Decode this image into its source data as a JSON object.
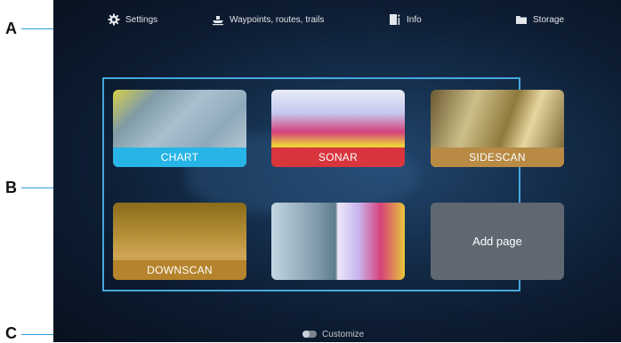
{
  "callouts": {
    "a": "A",
    "b": "B",
    "c": "C"
  },
  "top_bar": {
    "settings": {
      "label": "Settings",
      "icon": "gear-icon"
    },
    "waypoints": {
      "label": "Waypoints, routes, trails",
      "icon": "boat-icon"
    },
    "info": {
      "label": "Info",
      "icon": "info-icon"
    },
    "storage": {
      "label": "Storage",
      "icon": "folder-icon"
    }
  },
  "pages": {
    "chart": "CHART",
    "sonar": "SONAR",
    "sidescan": "SIDESCAN",
    "downscan": "DOWNSCAN",
    "add_page": "Add page"
  },
  "footer": {
    "customize": "Customize",
    "toggle_icon": "toggle-icon"
  },
  "colors": {
    "accent": "#45a8dc",
    "chart": "#27b4e6",
    "sonar": "#d8353d",
    "sidescan": "#b88a44",
    "downscan": "#b4832b",
    "add_page": "#5f6871"
  }
}
